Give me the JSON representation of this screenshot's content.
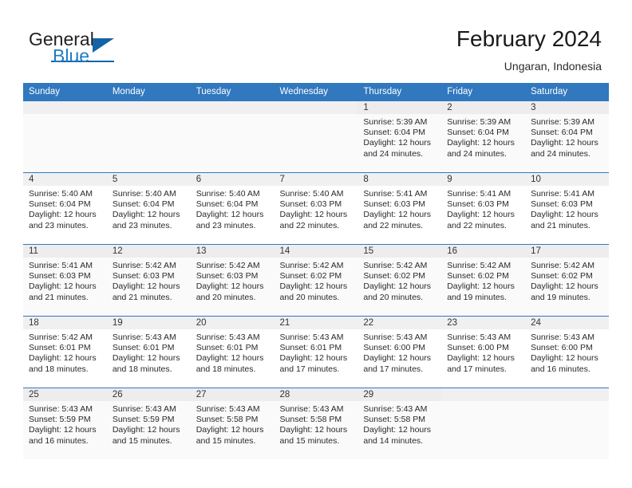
{
  "brand": {
    "name_top": "General",
    "name_bottom": "Blue",
    "accent_color": "#1464a5",
    "logo_icon": "triangle-icon"
  },
  "header": {
    "title": "February 2024",
    "location": "Ungaran, Indonesia"
  },
  "calendar": {
    "header_bg": "#3178be",
    "header_text_color": "#ffffff",
    "weekdays": [
      "Sunday",
      "Monday",
      "Tuesday",
      "Wednesday",
      "Thursday",
      "Friday",
      "Saturday"
    ],
    "labels": {
      "sunrise": "Sunrise:",
      "sunset": "Sunset:",
      "daylight": "Daylight:"
    },
    "weeks": [
      [
        {
          "day": "",
          "sunrise": "",
          "sunset": "",
          "daylight": ""
        },
        {
          "day": "",
          "sunrise": "",
          "sunset": "",
          "daylight": ""
        },
        {
          "day": "",
          "sunrise": "",
          "sunset": "",
          "daylight": ""
        },
        {
          "day": "",
          "sunrise": "",
          "sunset": "",
          "daylight": ""
        },
        {
          "day": "1",
          "sunrise": "Sunrise: 5:39 AM",
          "sunset": "Sunset: 6:04 PM",
          "daylight": "Daylight: 12 hours and 24 minutes."
        },
        {
          "day": "2",
          "sunrise": "Sunrise: 5:39 AM",
          "sunset": "Sunset: 6:04 PM",
          "daylight": "Daylight: 12 hours and 24 minutes."
        },
        {
          "day": "3",
          "sunrise": "Sunrise: 5:39 AM",
          "sunset": "Sunset: 6:04 PM",
          "daylight": "Daylight: 12 hours and 24 minutes."
        }
      ],
      [
        {
          "day": "4",
          "sunrise": "Sunrise: 5:40 AM",
          "sunset": "Sunset: 6:04 PM",
          "daylight": "Daylight: 12 hours and 23 minutes."
        },
        {
          "day": "5",
          "sunrise": "Sunrise: 5:40 AM",
          "sunset": "Sunset: 6:04 PM",
          "daylight": "Daylight: 12 hours and 23 minutes."
        },
        {
          "day": "6",
          "sunrise": "Sunrise: 5:40 AM",
          "sunset": "Sunset: 6:04 PM",
          "daylight": "Daylight: 12 hours and 23 minutes."
        },
        {
          "day": "7",
          "sunrise": "Sunrise: 5:40 AM",
          "sunset": "Sunset: 6:03 PM",
          "daylight": "Daylight: 12 hours and 22 minutes."
        },
        {
          "day": "8",
          "sunrise": "Sunrise: 5:41 AM",
          "sunset": "Sunset: 6:03 PM",
          "daylight": "Daylight: 12 hours and 22 minutes."
        },
        {
          "day": "9",
          "sunrise": "Sunrise: 5:41 AM",
          "sunset": "Sunset: 6:03 PM",
          "daylight": "Daylight: 12 hours and 22 minutes."
        },
        {
          "day": "10",
          "sunrise": "Sunrise: 5:41 AM",
          "sunset": "Sunset: 6:03 PM",
          "daylight": "Daylight: 12 hours and 21 minutes."
        }
      ],
      [
        {
          "day": "11",
          "sunrise": "Sunrise: 5:41 AM",
          "sunset": "Sunset: 6:03 PM",
          "daylight": "Daylight: 12 hours and 21 minutes."
        },
        {
          "day": "12",
          "sunrise": "Sunrise: 5:42 AM",
          "sunset": "Sunset: 6:03 PM",
          "daylight": "Daylight: 12 hours and 21 minutes."
        },
        {
          "day": "13",
          "sunrise": "Sunrise: 5:42 AM",
          "sunset": "Sunset: 6:03 PM",
          "daylight": "Daylight: 12 hours and 20 minutes."
        },
        {
          "day": "14",
          "sunrise": "Sunrise: 5:42 AM",
          "sunset": "Sunset: 6:02 PM",
          "daylight": "Daylight: 12 hours and 20 minutes."
        },
        {
          "day": "15",
          "sunrise": "Sunrise: 5:42 AM",
          "sunset": "Sunset: 6:02 PM",
          "daylight": "Daylight: 12 hours and 20 minutes."
        },
        {
          "day": "16",
          "sunrise": "Sunrise: 5:42 AM",
          "sunset": "Sunset: 6:02 PM",
          "daylight": "Daylight: 12 hours and 19 minutes."
        },
        {
          "day": "17",
          "sunrise": "Sunrise: 5:42 AM",
          "sunset": "Sunset: 6:02 PM",
          "daylight": "Daylight: 12 hours and 19 minutes."
        }
      ],
      [
        {
          "day": "18",
          "sunrise": "Sunrise: 5:42 AM",
          "sunset": "Sunset: 6:01 PM",
          "daylight": "Daylight: 12 hours and 18 minutes."
        },
        {
          "day": "19",
          "sunrise": "Sunrise: 5:43 AM",
          "sunset": "Sunset: 6:01 PM",
          "daylight": "Daylight: 12 hours and 18 minutes."
        },
        {
          "day": "20",
          "sunrise": "Sunrise: 5:43 AM",
          "sunset": "Sunset: 6:01 PM",
          "daylight": "Daylight: 12 hours and 18 minutes."
        },
        {
          "day": "21",
          "sunrise": "Sunrise: 5:43 AM",
          "sunset": "Sunset: 6:01 PM",
          "daylight": "Daylight: 12 hours and 17 minutes."
        },
        {
          "day": "22",
          "sunrise": "Sunrise: 5:43 AM",
          "sunset": "Sunset: 6:00 PM",
          "daylight": "Daylight: 12 hours and 17 minutes."
        },
        {
          "day": "23",
          "sunrise": "Sunrise: 5:43 AM",
          "sunset": "Sunset: 6:00 PM",
          "daylight": "Daylight: 12 hours and 17 minutes."
        },
        {
          "day": "24",
          "sunrise": "Sunrise: 5:43 AM",
          "sunset": "Sunset: 6:00 PM",
          "daylight": "Daylight: 12 hours and 16 minutes."
        }
      ],
      [
        {
          "day": "25",
          "sunrise": "Sunrise: 5:43 AM",
          "sunset": "Sunset: 5:59 PM",
          "daylight": "Daylight: 12 hours and 16 minutes."
        },
        {
          "day": "26",
          "sunrise": "Sunrise: 5:43 AM",
          "sunset": "Sunset: 5:59 PM",
          "daylight": "Daylight: 12 hours and 15 minutes."
        },
        {
          "day": "27",
          "sunrise": "Sunrise: 5:43 AM",
          "sunset": "Sunset: 5:58 PM",
          "daylight": "Daylight: 12 hours and 15 minutes."
        },
        {
          "day": "28",
          "sunrise": "Sunrise: 5:43 AM",
          "sunset": "Sunset: 5:58 PM",
          "daylight": "Daylight: 12 hours and 15 minutes."
        },
        {
          "day": "29",
          "sunrise": "Sunrise: 5:43 AM",
          "sunset": "Sunset: 5:58 PM",
          "daylight": "Daylight: 12 hours and 14 minutes."
        },
        {
          "day": "",
          "sunrise": "",
          "sunset": "",
          "daylight": ""
        },
        {
          "day": "",
          "sunrise": "",
          "sunset": "",
          "daylight": ""
        }
      ]
    ]
  }
}
